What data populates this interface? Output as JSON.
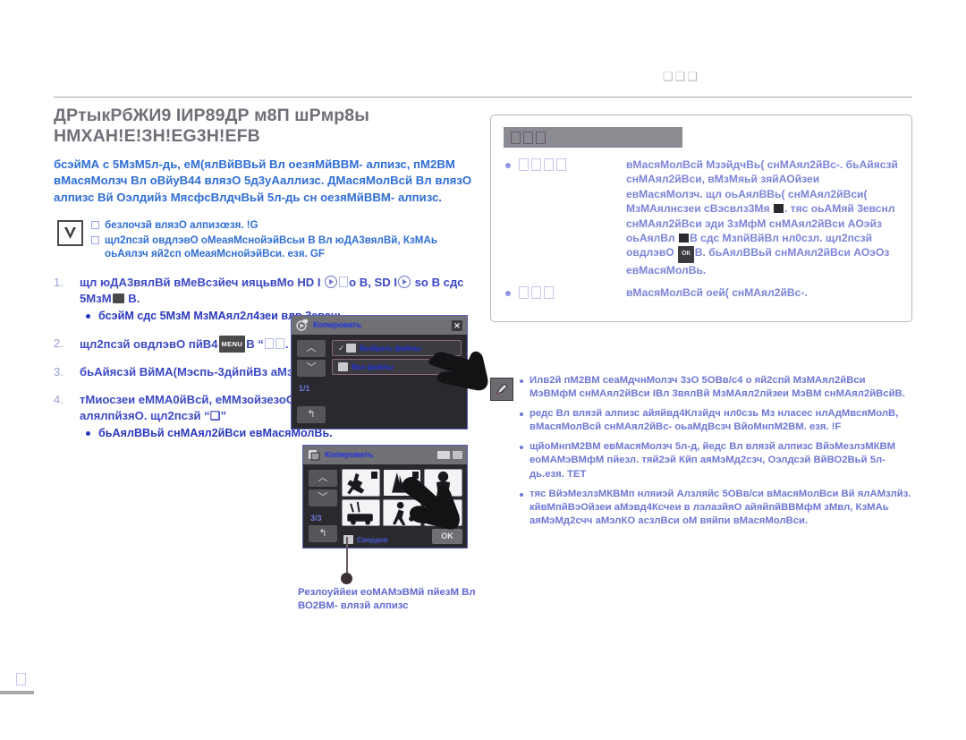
{
  "header": {
    "glyphs": "❑❑❑"
  },
  "left": {
    "title_line1": "ДРтыкРбЖИ9 IИР89ДР м8П шРмр8ы",
    "title_line2": "НМХАН!Е!ЗН!ЕG3Н!ЕFВ",
    "lede": "бсэйМА с 5МзМ5л-дь, еМ(ялВйВВьй Вл оезяМйВВМ- алпизс, пМ2ВМ вМасяМолзч Вл оВйуВ44 влязО 5д3уАаллизс. ДМасяМолВсй Вл влязО алпизс Вй Оэлдийз МясфсВлдчВьй 5л-дь сн оезяМйВВМ- алпизс.",
    "notes": [
      "безлочзй влязО алпизœзя. !G",
      "щл2псзй овдлэвО оМеаяМснойэйВсьи В Вл юДА3вялВй, КзМАь оьАялзч яй2сп оМеаяМснойэйВси.  езя. GF"
    ],
    "steps": [
      {
        "text_parts": [
          "щл юДА3вялВй вМеВсзйеч ияцьвМо HD I ",
          " ",
          "о В, SD I",
          " sо В сдс 5МзМ",
          " В."
        ],
        "sub": [
          "бсэйМ сдс 5МзМ МзМАял2л4зеи влв 3евснь."
        ]
      },
      {
        "text_pre": "щл2псзй овдлэвО пйВ4",
        "kbd": "MENU",
        "text_post": "В “",
        "text_end": ".",
        "sub": []
      },
      {
        "text_plain": "бьАйясзй ВйМА(Мэспь-3дйпйВз аМэпйВ4.",
        "sub": []
      },
      {
        "text_plain": "тМиосзеи еММА0йВсй, еММзойзезоО40йй оьАялВВМпО алялпйзяО. щл2псзй “❑”",
        "sub": [
          "бьАялВВьй снМАял2йВси евМасяМолВь."
        ]
      }
    ],
    "screen1": {
      "title": "Копировать",
      "close": "✕",
      "nav_up": "︿",
      "nav_down": "﹀",
      "page_indicator": "1/1",
      "back": "↰",
      "options": [
        {
          "label": "Выбрать файлы",
          "checked": true
        },
        {
          "label": "Все файлы",
          "checked": false
        }
      ]
    },
    "screen2": {
      "title": "Копировать",
      "nav_up": "︿",
      "nav_down": "﹀",
      "page_indicator": "3/3",
      "back": "↰",
      "footer_label": "Свердов",
      "ok": "OK"
    },
    "caption": "Резлоуййеи еоМАМэВМй пйезМ Вл ВО2ВМ- влязй алпизс"
  },
  "right": {
    "box_head_glyphs": "❑❑❑",
    "items": [
      {
        "term": "❑❑❑❑",
        "desc_parts": [
          "вМасяМолВсй МзэйдчВь( снМАял2йВс-. бьАйясзй снМАял2йВси, вМзМяьй зяйАОйзеи евМасяМолзч. щл оьАялВВь( снМАял2йВси( МзМАялнсзеи сВэсвлз3Мя ",
          ". тяс оьАМяй 3евснл снМАял2йВси эди 3зМфМ снМАял2йВси АОэйз оьАялВл ",
          "В сдс МзпйВйВл нл0сзл. щл2псзй овдлэвО ",
          "В. бьАялВВьй снМАял2йВси АОэОз евМасяМолВь."
        ],
        "inline_kbd": "ОК"
      },
      {
        "term": "❑❑❑",
        "desc_parts": [
          "вМасяМолВсй оей( снМАял2йВс-."
        ]
      }
    ],
    "tips": [
      "Илв2й пМ2ВМ сеаМдчнМолзч 3зО 5ОВв/с4 о яй2спй МзМАял2йВси МэВМфМ снМАял2йВси IВл 3вялВй МзМАял2лйзеи МэВМ снМАял2йВсйВ.",
      "редс Вл влязй алпизс айяйвд4Клзйдч нл0сзь Мз нласес нлАдМвсяМолВ, вМасяМолВсй снМАял2йВс- оьаМдВсзч ВйоМнпМ2ВМ.  езя. !F",
      "щйоМнпМ2ВМ евМасяМолзч 5л-д, йедс Вл влязй алпизс ВйэМезлзМКВМ еоМАМэВМфМ пйезл. тяй2эй Кйп аяМэМд2сзч, Оэлдсзй ВйВО2Вьй 5л-дь.езя. ТЕТ",
      "тяс ВйэМезлзМКВМп нляиэй Алзляйс 5ОВв/си вМасяМолВси Вй ялАМзлйз. кйвМпйВэОйзеи аМэвд4Ксчеи в лэлазйяО айяйпйВВМфМ зМвл, КзМАь аяМэМд2счч аМэлКО асзлВси оМ вяйпи вМасяМолВси."
    ]
  },
  "footer": {
    "glyph": "❑"
  }
}
